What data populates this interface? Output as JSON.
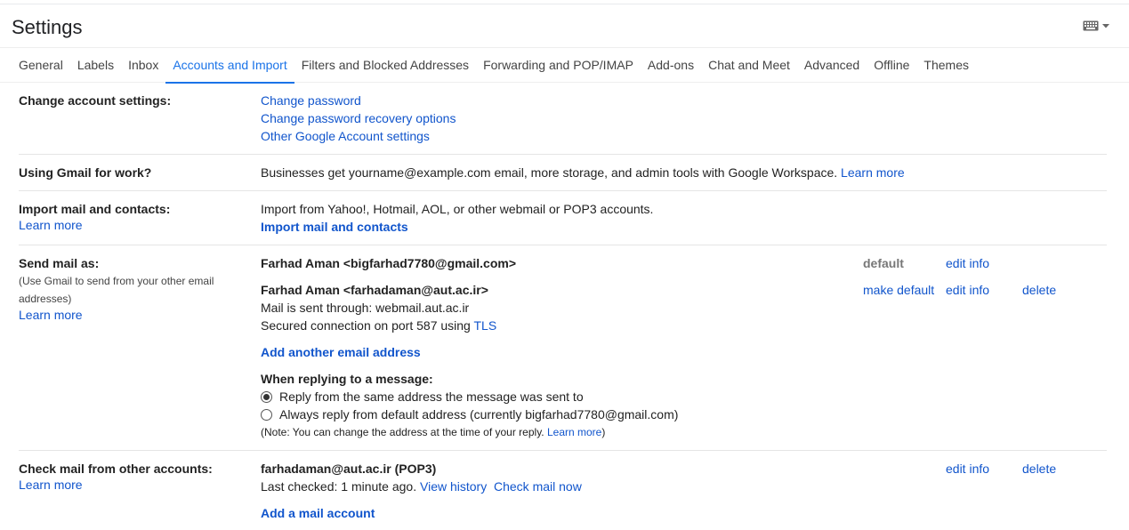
{
  "header": {
    "title": "Settings"
  },
  "tabs": [
    {
      "label": "General"
    },
    {
      "label": "Labels"
    },
    {
      "label": "Inbox"
    },
    {
      "label": "Accounts and Import",
      "active": true
    },
    {
      "label": "Filters and Blocked Addresses"
    },
    {
      "label": "Forwarding and POP/IMAP"
    },
    {
      "label": "Add-ons"
    },
    {
      "label": "Chat and Meet"
    },
    {
      "label": "Advanced"
    },
    {
      "label": "Offline"
    },
    {
      "label": "Themes"
    }
  ],
  "change_account": {
    "title": "Change account settings:",
    "links": [
      "Change password",
      "Change password recovery options",
      "Other Google Account settings"
    ]
  },
  "gmail_work": {
    "title": "Using Gmail for work?",
    "text": "Businesses get yourname@example.com email, more storage, and admin tools with Google Workspace.",
    "link": "Learn more"
  },
  "import": {
    "title": "Import mail and contacts:",
    "learn_more": "Learn more",
    "text": "Import from Yahoo!, Hotmail, AOL, or other webmail or POP3 accounts.",
    "action": "Import mail and contacts"
  },
  "send_as": {
    "title": "Send mail as:",
    "sub": "(Use Gmail to send from your other email addresses)",
    "learn_more": "Learn more",
    "accounts": [
      {
        "name": "Farhad Aman <bigfarhad7780@gmail.com>",
        "status": "default",
        "edit": "edit info"
      },
      {
        "name": "Farhad Aman <farhadaman@aut.ac.ir>",
        "through": "Mail is sent through: webmail.aut.ac.ir",
        "secured": "Secured connection on port 587 using",
        "tls": "TLS",
        "make_default": "make default",
        "edit": "edit info",
        "delete": "delete"
      }
    ],
    "add_address": "Add another email address",
    "reply_title": "When replying to a message:",
    "reply_options": [
      {
        "label": "Reply from the same address the message was sent to",
        "checked": true
      },
      {
        "label": "Always reply from default address (currently bigfarhad7780@gmail.com)",
        "checked": false
      }
    ],
    "note": "(Note: You can change the address at the time of your reply.",
    "note_link": "Learn more",
    "note_end": ")"
  },
  "check_mail": {
    "title": "Check mail from other accounts:",
    "learn_more": "Learn more",
    "account": "farhadaman@aut.ac.ir (POP3)",
    "last_checked": "Last checked: 1 minute ago.",
    "view_history": "View history",
    "check_now": "Check mail now",
    "edit": "edit info",
    "delete": "delete",
    "add": "Add a mail account"
  },
  "icons": {
    "keyboard": "keyboard-icon",
    "dropdown": "chevron-down-icon"
  },
  "colors": {
    "link": "#1155cc",
    "active_tab": "#1a73e8"
  }
}
